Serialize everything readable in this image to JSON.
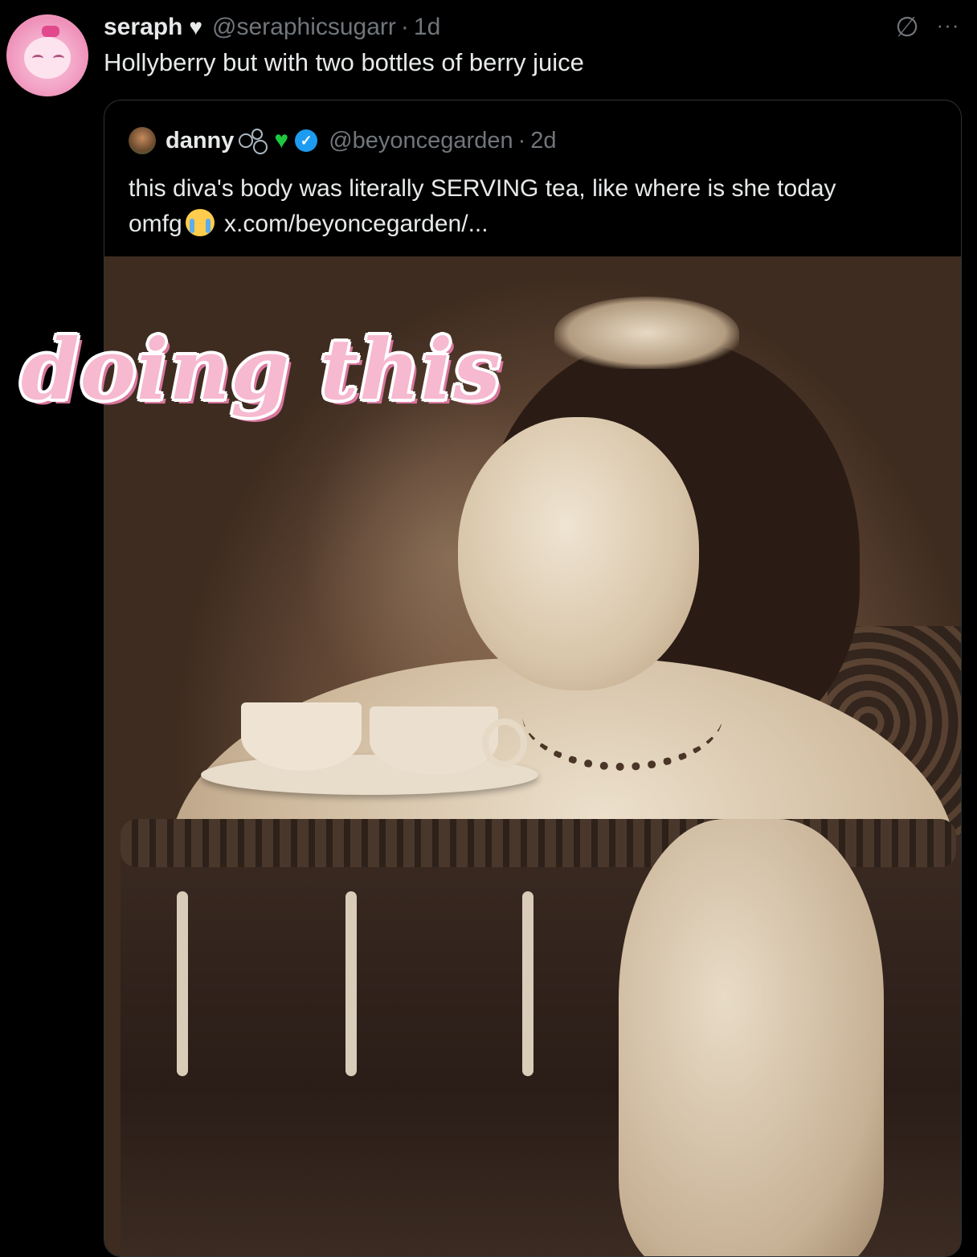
{
  "tweet": {
    "display_name": "seraph",
    "name_emoji": "heart",
    "handle": "@seraphicsugarr",
    "separator": "·",
    "time": "1d",
    "text": "Hollyberry but with two bottles of berry juice",
    "grok_glyph": "∅",
    "more_glyph": "···"
  },
  "quote": {
    "display_name": "danny",
    "handle": "@beyoncegarden",
    "separator": "·",
    "time": "2d",
    "text_line1": "this diva's body was literally SERVING tea, like where is she today",
    "text_line2_prefix": "omfg",
    "link": "x.com/beyoncegarden/..."
  },
  "overlay": {
    "caption": "doing this"
  },
  "colors": {
    "background": "#000000",
    "text": "#e7e9ea",
    "muted": "#71767b",
    "verified": "#1d9bf0",
    "green_heart": "#1ec93f",
    "caption_pink": "#f6b9cf"
  },
  "icons": [
    "heart-icon",
    "grok-icon",
    "more-icon",
    "bubbles-icon",
    "green-heart-icon",
    "verified-badge-icon",
    "crying-face-emoji"
  ]
}
